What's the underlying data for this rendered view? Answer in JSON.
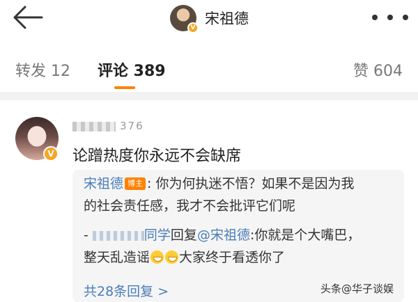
{
  "header": {
    "back_icon": "arrow-left-icon",
    "title": "宋祖德",
    "verified_badge": "V",
    "more_icon": "more-dots-icon"
  },
  "tabs": {
    "repost": "转发 12",
    "comments": "评论 389",
    "likes": "赞 604",
    "active": "comments",
    "accent_color": "#ff8200"
  },
  "comment": {
    "username_visible": "376",
    "verified_badge": "V",
    "text": "论蹭热度你永远不会缺席",
    "replies": {
      "author": "宋祖德",
      "author_badge": "博主",
      "line1_text": ": 你为何执迷不悟？如果不是因为我",
      "line2_text": "的社会责任感，我才不会批评它们呢",
      "reply_prefix": "- ",
      "reply_user_suffix": "同学",
      "reply_verb": "回复",
      "reply_mention": "@宋祖德",
      "reply_text": ":你就是个大嘴巴，",
      "reply_line2_a": "整天乱造谣",
      "reply_line2_b": "大家终于看透你了",
      "more": "共28条回复 >",
      "link_color": "#4a7db8"
    }
  },
  "watermark": "头条@华子谈娱"
}
